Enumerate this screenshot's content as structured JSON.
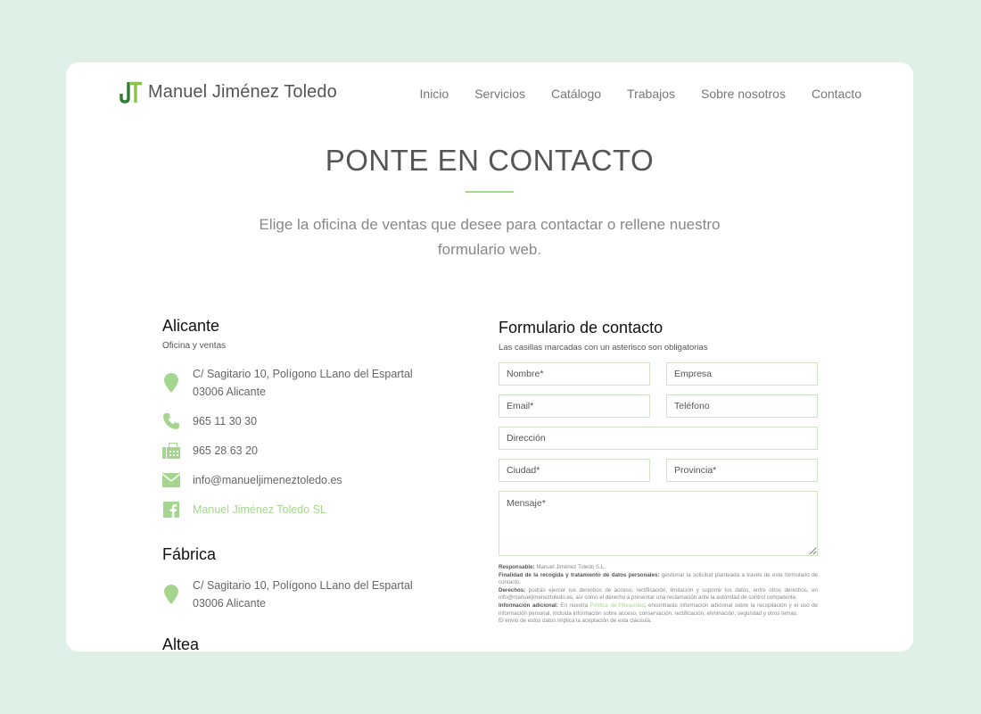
{
  "brand": {
    "logo_letters": "JT",
    "name": "Manuel Jiménez Toledo",
    "accent": "#a5d68f",
    "logo_dark": "#2e7d32"
  },
  "nav": [
    "Inicio",
    "Servicios",
    "Catálogo",
    "Trabajos",
    "Sobre nosotros",
    "Contacto"
  ],
  "hero": {
    "title": "PONTE EN CONTACTO",
    "subtitle": "Elige la oficina de ventas que desee para contactar o rellene nuestro formulario web."
  },
  "offices": {
    "alicante": {
      "name": "Alicante",
      "sub": "Oficina y ventas",
      "address1": "C/ Sagitario 10, Polígono LLano del Espartal",
      "address2": "03006 Alicante",
      "phone": "965 11 30 30",
      "fax": "965 28 63 20",
      "email": "info@manueljimeneztoledo.es",
      "facebook": "Manuel Jiménez Toledo SL"
    },
    "fabrica": {
      "name": "Fábrica",
      "address1": "C/ Sagitario 10, Polígono LLano del Espartal",
      "address2": "03006 Alicante"
    },
    "altea": {
      "name": "Altea"
    }
  },
  "form": {
    "title": "Formulario de contacto",
    "sub": "Las casillas marcadas con un asterisco son obligatorias",
    "fields": {
      "nombre": "Nombre*",
      "empresa": "Empresa",
      "email": "Email*",
      "telefono": "Teléfono",
      "direccion": "Dirección",
      "ciudad": "Ciudad*",
      "provincia": "Provincia*",
      "mensaje": "Mensaje*"
    },
    "legal": {
      "responsable_label": "Responsable:",
      "responsable": "Manuel Jiménez Toledo S.L.",
      "finalidad_label": "Finalidad de la recogida y tratamiento de datos personales:",
      "finalidad": "gestionar la solicitud planteada a través de este formulario de contacto.",
      "derechos_label": "Derechos:",
      "derechos": "podrás ejercer tus derechos de acceso, rectificación, limitación y suprimir los datos, entre otros derechos, en info@manueljimeneztoledo.es, así como el derecho a presentar una reclamación ante la autoridad de control competente.",
      "adicional_label": "Información adicional:",
      "adicional_pre": "En nuestra",
      "adicional_link": "Política de Privacidad",
      "adicional_post": ", encontrarás información adicional sobre la recopilación y el uso de información personal, incluida información sobre acceso, conservación, rectificación, eliminación, seguridad y otros temas.",
      "envio": "El envío de estos datos implica la aceptación de esta cláusula."
    }
  }
}
